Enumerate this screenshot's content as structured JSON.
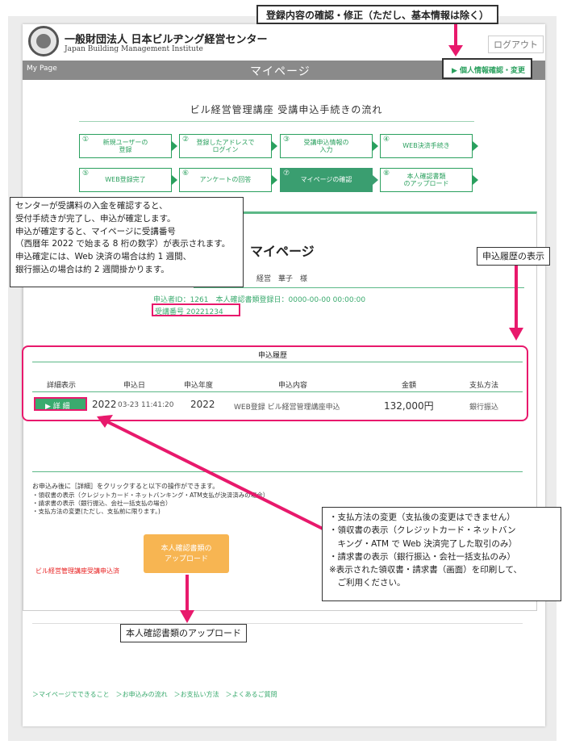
{
  "header": {
    "org_name_jp": "一般財団法人 日本ビルヂング経営センター",
    "org_name_en": "Japan Building Management Institute",
    "logout": "ログアウト",
    "mypage_en": "My Page",
    "mypage_jp": "マイページ",
    "info_button": "▶ 個人情報確認・変更"
  },
  "flow": {
    "title": "ビル経営管理講座 受講申込手続きの流れ",
    "steps": [
      {
        "num": "①",
        "label": "新規ユーザーの\n登録"
      },
      {
        "num": "②",
        "label": "登録したアドレスで\nログイン"
      },
      {
        "num": "③",
        "label": "受講申込情報の\n入力"
      },
      {
        "num": "④",
        "label": "WEB決済手続き"
      },
      {
        "num": "⑤",
        "label": "WEB登録完了"
      },
      {
        "num": "⑥",
        "label": "アンケートの回答"
      },
      {
        "num": "⑦",
        "label": "マイページの確認"
      },
      {
        "num": "⑧",
        "label": "本人確認書類\nのアップロード"
      }
    ],
    "active_index": 6
  },
  "main": {
    "title": "マイページ",
    "user_name": "経営　華子　様",
    "application_info": "申込者ID：1261　本人確認書類登録日：0000-00-00 00:00:00",
    "receipt_number": "受講番号  20221234"
  },
  "history": {
    "title": "申込履歴",
    "columns": [
      "詳細表示",
      "申込日",
      "申込年度",
      "申込内容",
      "金額",
      "支払方法"
    ],
    "row": {
      "detail_button": "▶ 詳 細",
      "date_year": "2022",
      "date_rest": "03-23 11:41:20",
      "fiscal_year": "2022",
      "content": "WEB登録 ビル経営管理講座申込",
      "amount": "132,000円",
      "payment": "銀行振込"
    }
  },
  "notes": {
    "intro": "お申込み後に［詳細］をクリックすると以下の操作ができます。",
    "items": [
      "・領収書の表示（クレジットカード・ネットバンキング・ATM支払が決済済みの場合）",
      "・請求書の表示（銀行振込、会社一括支払の場合）",
      "・支払方法の変更(ただし、支払前に限ります。)"
    ],
    "course_label": "ビル経営管理講座受講申込済",
    "upload_button": "本人確認書類の\nアップロード"
  },
  "footer": {
    "links": "＞マイページでできること　＞お申込みの流れ　＞お支払い方法　＞よくあるご質問"
  },
  "callouts": {
    "top": "登録内容の確認・修正（ただし、基本情報は除く）",
    "left": "センターが受講料の入金を確認すると、\n受付手続きが完了し、申込が確定します。\n申込が確定すると、マイページに受講番号\n（西暦年 2022 で始まる 8 桁の数字）が表示されます。\n申込確定には、Web 決済の場合は約 1 週間、\n銀行振込の場合は約 2 週間掛かります。",
    "history": "申込履歴の表示",
    "right": [
      "・支払方法の変更（支払後の変更はできません）",
      "・領収書の表示（クレジットカード・ネットバン",
      "　キング・ATM で Web 決済完了した取引のみ）",
      "・請求書の表示（銀行振込・会社一括支払のみ）",
      "※表示された領収書・請求書（画面）を印刷して、",
      "　ご利用ください。"
    ],
    "upload": "本人確認書類のアップロード"
  },
  "colors": {
    "accent_green": "#3aaa6e",
    "annotation_pink": "#e8196c",
    "upload_orange": "#f7b552",
    "header_grey": "#8a8a8a"
  }
}
